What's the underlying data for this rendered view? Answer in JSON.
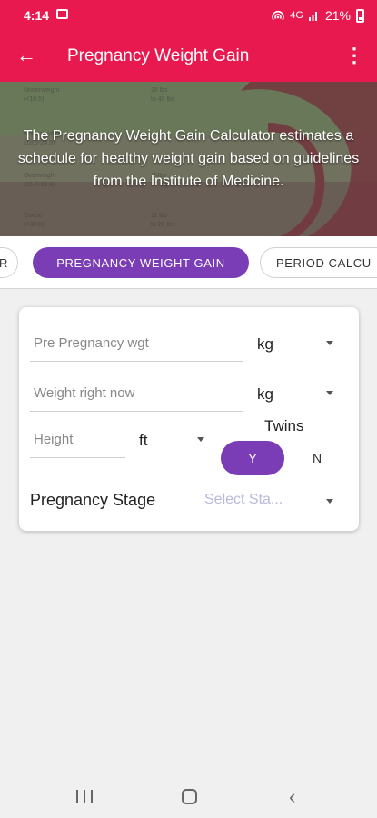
{
  "status_bar": {
    "time": "4:14",
    "signal": "4G",
    "battery": "21%",
    "icons": [
      "gallery-icon",
      "hotspot-icon",
      "signal-icon",
      "battery-icon"
    ]
  },
  "app_bar": {
    "title": "Pregnancy Weight Gain",
    "back_icon": "←",
    "more_icon": "⋮"
  },
  "hero": {
    "description": "The Pregnancy Weight Gain Calculator estimates a schedule for healthy weight gain based on guidelines from the Institute of Medicine.",
    "faint_table": [
      {
        "category": "Underweight",
        "range": "(<18.5)",
        "gain": "28 lbs",
        "gain2": "to 40 lbs"
      },
      {
        "category": "Normal weight",
        "range": "(18.5-24.9)",
        "gain": "",
        "gain2": ""
      },
      {
        "category": "Overweight",
        "range": "(25.0-29.9)",
        "gain": "15lbs",
        "gain2": ""
      },
      {
        "category": "Obese",
        "range": "(>30.0)",
        "gain": "11 lbs",
        "gain2": "to 20 lbs"
      }
    ]
  },
  "tabs": {
    "prev": "R",
    "active": "PREGNANCY WEIGHT GAIN",
    "next": "PERIOD CALCU"
  },
  "form": {
    "pre_weight_placeholder": "Pre Pregnancy wgt",
    "pre_weight_unit": "kg",
    "current_weight_placeholder": "Weight right now",
    "current_weight_unit": "kg",
    "height_placeholder": "Height",
    "height_unit": "ft",
    "twins_label": "Twins",
    "twins_yes": "Y",
    "twins_no": "N",
    "twins_selected": "Y",
    "stage_label": "Pregnancy Stage",
    "stage_placeholder": "Select Sta..."
  },
  "colors": {
    "primary": "#e8194f",
    "accent": "#7b3db6"
  },
  "nav_bar": {
    "icons": [
      "recents-icon",
      "home-icon",
      "back-icon"
    ],
    "back_glyph": "‹"
  }
}
